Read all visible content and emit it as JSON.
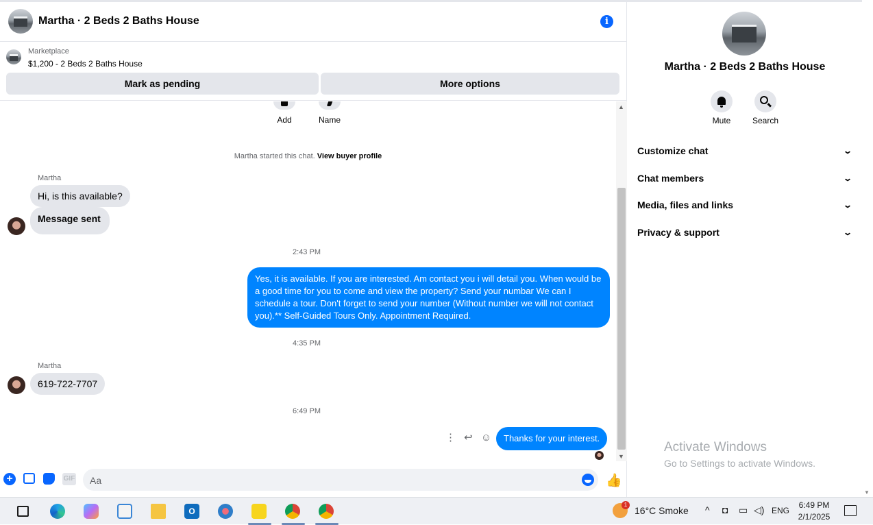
{
  "chat": {
    "title": "Martha · 2 Beds 2 Baths House",
    "listing": {
      "source": "Marketplace",
      "title": "$1,200 - 2 Beds 2 Baths House"
    },
    "buttons": {
      "pending": "Mark as pending",
      "more": "More options"
    },
    "quick_actions": {
      "add": "Add",
      "name": "Name"
    },
    "started_text": "Martha started this chat.",
    "buyer_profile_link": "View buyer profile",
    "messages": {
      "sender1": "Martha",
      "in1": "Hi, is this available?",
      "in2": "Message sent",
      "time1": "2:43 PM",
      "out1": "Yes, it is available. If you are interested.  Am contact you i will detail you.  When would be a good time for you to come and view the property? Send your numbar We can I schedule a tour.  Don't forget to send your number (Without number we will not contact you).** Self-Guided Tours Only. Appointment Required.",
      "time2": "4:35 PM",
      "sender2": "Martha",
      "in3": "619-722-7707",
      "time3": "6:49 PM",
      "out2": "Thanks for your interest."
    },
    "composer_placeholder": "Aa",
    "gif_label": "GIF"
  },
  "side_panel": {
    "title": "Martha · 2 Beds 2 Baths House",
    "actions": {
      "mute": "Mute",
      "search": "Search"
    },
    "sections": {
      "customize": "Customize chat",
      "members": "Chat members",
      "media": "Media, files and links",
      "privacy": "Privacy & support"
    }
  },
  "watermark": {
    "line1": "Activate Windows",
    "line2": "Go to Settings to activate Windows."
  },
  "taskbar": {
    "weather_badge": "1",
    "weather": "16°C  Smoke",
    "language": "ENG",
    "time": "6:49 PM",
    "date": "2/1/2025"
  },
  "colors": {
    "accent": "#0866ff",
    "bubble_out": "#0084ff",
    "bubble_in": "#e4e6eb"
  }
}
